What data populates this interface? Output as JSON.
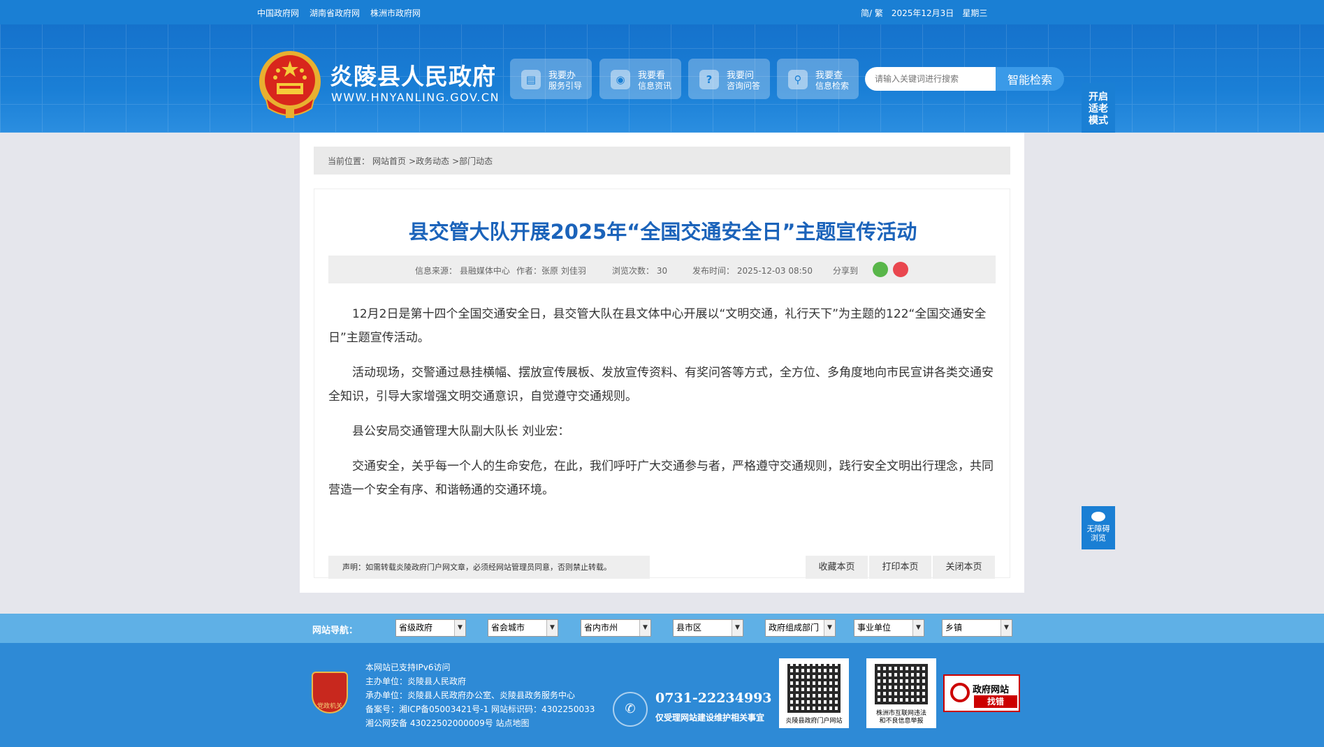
{
  "topbar": {
    "links": [
      "中国政府网",
      "湖南省政府网",
      "株洲市政府网"
    ],
    "lang": "简/ 繁",
    "date": "2025年12月3日",
    "weekday": "星期三"
  },
  "header": {
    "title": "炎陵县人民政府",
    "domain": "WWW.HNYANLING.GOV.CN",
    "nav": [
      {
        "l1": "我要办",
        "l2": "服务引导",
        "icon": "document-icon"
      },
      {
        "l1": "我要看",
        "l2": "信息资讯",
        "icon": "eye-icon"
      },
      {
        "l1": "我要问",
        "l2": "咨询问答",
        "icon": "question-icon"
      },
      {
        "l1": "我要查",
        "l2": "信息检索",
        "icon": "search-icon"
      }
    ],
    "search_placeholder": "请输入关键词进行搜索",
    "search_button": "智能检索"
  },
  "side": {
    "elder_mode": [
      "开启",
      "适老",
      "模式"
    ],
    "accessibility": [
      "无障碍",
      "浏览"
    ]
  },
  "breadcrumb": {
    "label": "当前位置：",
    "items": [
      "网站首页",
      " >政务动态",
      " >部门动态"
    ]
  },
  "article": {
    "title": "县交管大队开展2025年“全国交通安全日”主题宣传活动",
    "source": "信息来源：  县融媒体中心",
    "author": "作者：张原 刘佳羽",
    "views": "浏览次数：  30",
    "published": "发布时间：  2025-12-03 08:50",
    "share": "分享到",
    "paragraphs": [
      "12月2日是第十四个全国交通安全日，县交管大队在县文体中心开展以“文明交通，礼行天下”为主题的122“全国交通安全日”主题宣传活动。",
      "活动现场，交警通过悬挂横幅、摆放宣传展板、发放宣传资料、有奖问答等方式，全方位、多角度地向市民宣讲各类交通安全知识，引导大家增强文明交通意识，自觉遵守交通规则。",
      "县公安局交通管理大队副大队长 刘业宏：",
      "交通安全，关乎每一个人的生命安危，在此，我们呼吁广大交通参与者，严格遵守交通规则，践行安全文明出行理念，共同营造一个安全有序、和谐畅通的交通环境。"
    ],
    "disclaimer": "声明：如需转载炎陵政府门户网文章，必须经网站管理员同意，否则禁止转载。",
    "actions": [
      "收藏本页",
      "打印本页",
      "关闭本页"
    ]
  },
  "sitenav": {
    "label": "网站导航：",
    "selects": [
      "省级政府",
      "省会城市",
      "省内市州",
      "县市区",
      "政府组成部门",
      "事业单位",
      "乡镇"
    ]
  },
  "footer": {
    "party_logo_text": "党政机关",
    "info": [
      "本网站已支持IPv6访问",
      "主办单位：炎陵县人民政府",
      "承办单位：炎陵县人民政府办公室、炎陵县政务服务中心",
      "备案号：湘ICP备05003421号-1 网站标识码：4302250033",
      "湘公网安备 43022502000009号 站点地图"
    ],
    "phone": "0731-22234993",
    "phone_note": "仅受理网站建设维护相关事宜",
    "qr1_caption": "炎陵县政府门户网站",
    "qr2_caption": [
      "株洲市互联网违法",
      "和不良信息举报"
    ],
    "findbug": [
      "政府网站",
      "找错"
    ]
  }
}
